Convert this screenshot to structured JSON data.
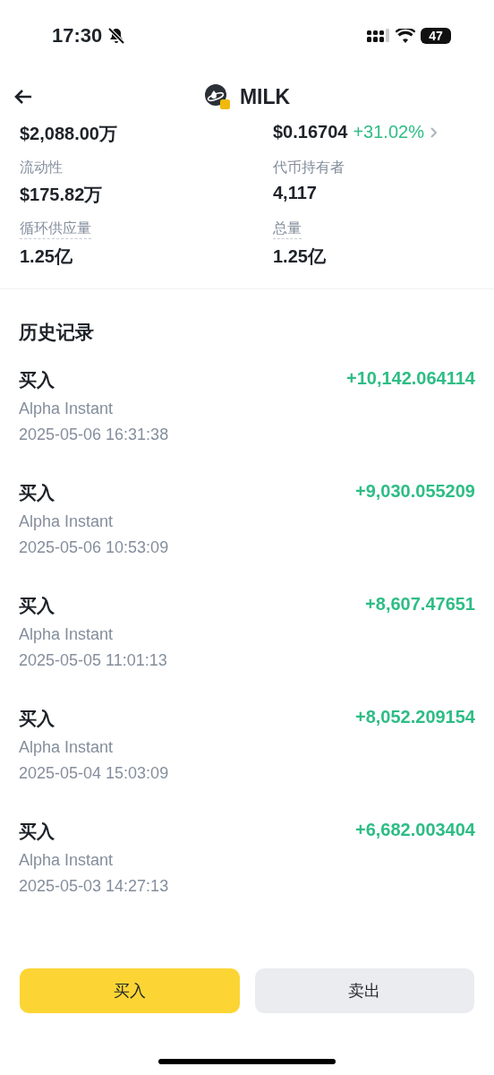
{
  "status_bar": {
    "time": "17:30",
    "silent": true,
    "battery": "47"
  },
  "header": {
    "title": "MILK"
  },
  "stats": [
    {
      "value": "$2,088.00万"
    },
    {
      "value": "$0.16704",
      "change": "+31.02%",
      "link": true
    },
    {
      "label": "流动性",
      "underlined": false,
      "value": "$175.82万"
    },
    {
      "label": "代币持有者",
      "underlined": false,
      "value": "4,117"
    },
    {
      "label": "循环供应量",
      "underlined": true,
      "value": "1.25亿"
    },
    {
      "label": "总量",
      "underlined": true,
      "value": "1.25亿"
    }
  ],
  "history": {
    "title": "历史记录",
    "rows": [
      {
        "type": "买入",
        "source": "Alpha Instant",
        "time": "2025-05-06 16:31:38",
        "amount": "+10,142.064114"
      },
      {
        "type": "买入",
        "source": "Alpha Instant",
        "time": "2025-05-06 10:53:09",
        "amount": "+9,030.055209"
      },
      {
        "type": "买入",
        "source": "Alpha Instant",
        "time": "2025-05-05 11:01:13",
        "amount": "+8,607.47651"
      },
      {
        "type": "买入",
        "source": "Alpha Instant",
        "time": "2025-05-04 15:03:09",
        "amount": "+8,052.209154"
      },
      {
        "type": "买入",
        "source": "Alpha Instant",
        "time": "2025-05-03 14:27:13",
        "amount": "+6,682.003404"
      }
    ]
  },
  "actions": [
    {
      "label": "买入",
      "kind": "primary"
    },
    {
      "label": "卖出",
      "kind": "secondary"
    }
  ]
}
